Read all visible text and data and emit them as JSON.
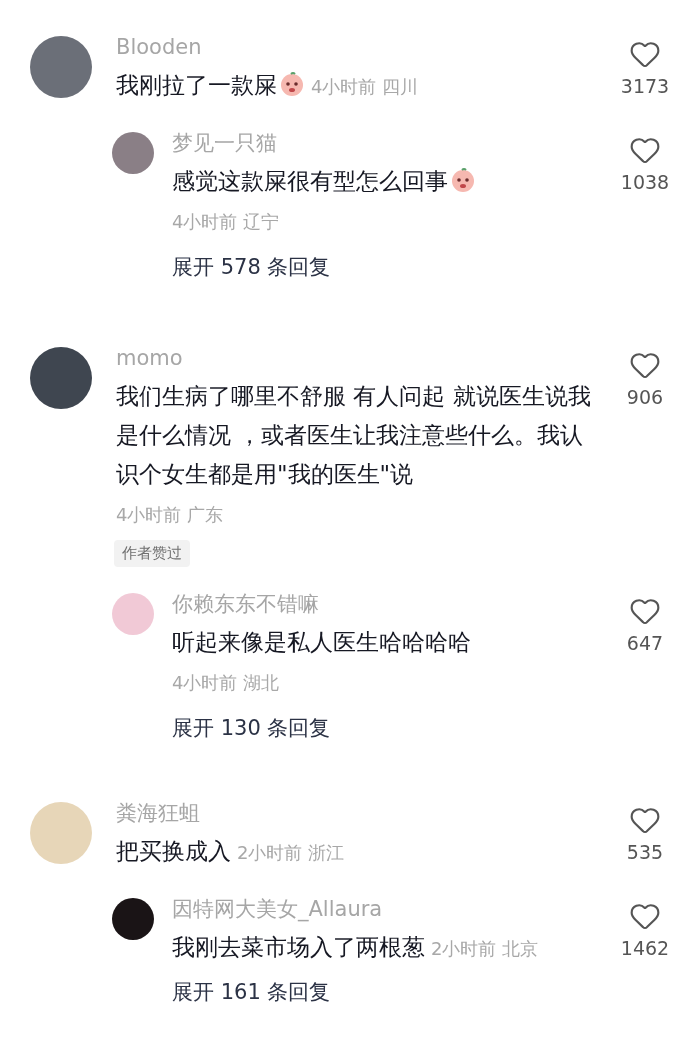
{
  "threads": [
    {
      "comment": {
        "name": "Blooden",
        "text": "我刚拉了一款屎",
        "emoji": true,
        "time": "4小时前 四川",
        "kind": "inline",
        "likes": "3173"
      },
      "reply": {
        "name": "梦见一只猫",
        "text": "感觉这款屎很有型怎么回事",
        "emoji": true,
        "time": "4小时前 辽宁",
        "kind": "below",
        "likes": "1038"
      },
      "expand": "展开 578 条回复"
    },
    {
      "comment": {
        "name": "momo",
        "text": "我们生病了哪里不舒服 有人问起 就说医生说我是什么情况 ，或者医生让我注意些什么。我认识个女生都是用\"我的医生\"说",
        "time": "4小时前 广东",
        "kind": "below",
        "badge": "作者赞过",
        "likes": "906"
      },
      "reply": {
        "name": "你赖东东不错嘛",
        "text": "听起来像是私人医生哈哈哈哈",
        "time": "4小时前 湖北",
        "kind": "below",
        "likes": "647"
      },
      "expand": "展开 130 条回复"
    },
    {
      "comment": {
        "name": "粪海狂蛆",
        "text": "把买换成入",
        "time": "2小时前 浙江",
        "kind": "inline",
        "likes": "535"
      },
      "reply": {
        "name": "因特网大美女_Allaura",
        "text": "我刚去菜市场入了两根葱",
        "time": "2小时前 北京",
        "kind": "inline",
        "likes": "1462"
      },
      "expand": "展开 161 条回复"
    }
  ]
}
